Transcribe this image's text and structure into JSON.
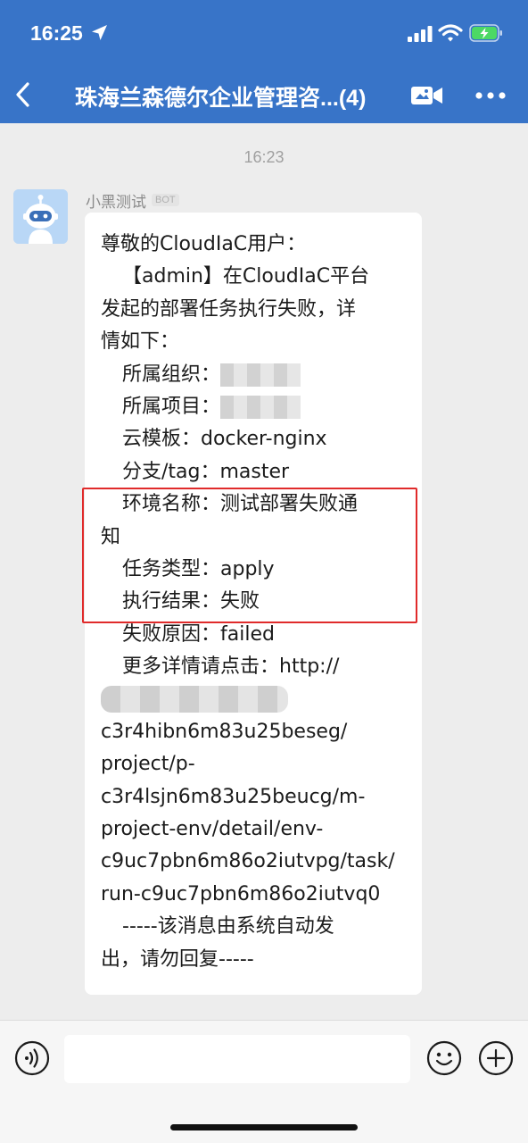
{
  "status_bar": {
    "time": "16:25"
  },
  "nav": {
    "title": "珠海兰森德尔企业管理咨...(4)"
  },
  "chat": {
    "timestamp": "16:23",
    "sender_name": "小黑测试",
    "sender_badge": "BOT",
    "message": {
      "lines": [
        "尊敬的CloudIaC用户：",
        "【admin】在CloudIaC平台",
        "发起的部署任务执行失败，详",
        "情如下：",
        "所属组织：",
        "所属项目：",
        "云模板：docker-nginx",
        "分支/tag：master",
        "环境名称：测试部署失败通",
        "知",
        "任务类型：apply",
        "执行结果：失败",
        "失败原因：failed",
        "更多详情请点击：http://",
        "c3r4hibn6m83u25beseg/",
        "project/p-",
        "c3r4lsjn6m83u25beucg/m-",
        "project-env/detail/env-",
        "c9uc7pbn6m86o2iutvpg/task/",
        "run-c9uc7pbn6m86o2iutvq0",
        "-----该消息由系统自动发",
        "出，请勿回复-----"
      ]
    }
  },
  "icons": {
    "back": "back-arrow-icon",
    "video": "video-call-icon",
    "more": "more-dots-icon",
    "voice": "voice-input-icon",
    "emoji": "emoji-icon",
    "plus": "plus-icon"
  },
  "colors": {
    "header_bg": "#3874c8",
    "highlight_border": "#e02b2b",
    "chat_bg": "#ededed",
    "battery_fill": "#4cd964"
  }
}
